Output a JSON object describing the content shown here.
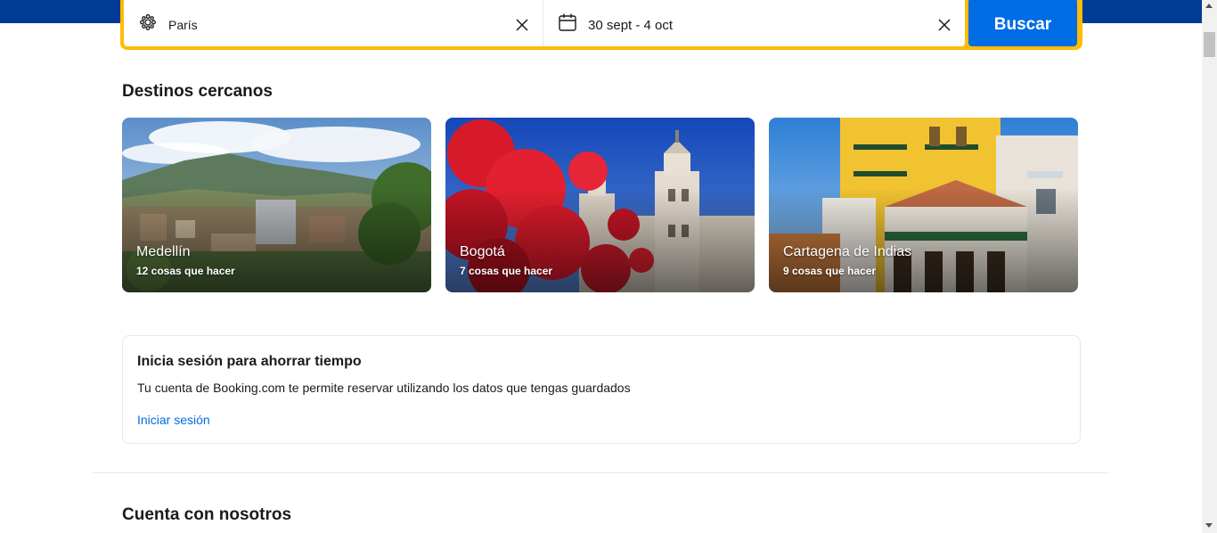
{
  "search": {
    "destination": "París",
    "destination_icon": "attraction-icon",
    "dates": "30 sept - 4 oct",
    "dates_icon": "calendar-icon",
    "button_label": "Buscar"
  },
  "nearby": {
    "title": "Destinos cercanos",
    "cards": [
      {
        "name": "Medellín",
        "subtitle": "12 cosas que hacer"
      },
      {
        "name": "Bogotá",
        "subtitle": "7 cosas que hacer"
      },
      {
        "name": "Cartagena de Indias",
        "subtitle": "9 cosas que hacer"
      }
    ]
  },
  "signin": {
    "title": "Inicia sesión para ahorrar tiempo",
    "text": "Tu cuenta de Booking.com te permite reservar utilizando los datos que tengas guardados",
    "link": "Iniciar sesión"
  },
  "footer_section": {
    "title": "Cuenta con nosotros"
  },
  "colors": {
    "brand_blue": "#003b95",
    "accent_yellow": "#febb02",
    "button_blue": "#006ce4"
  }
}
